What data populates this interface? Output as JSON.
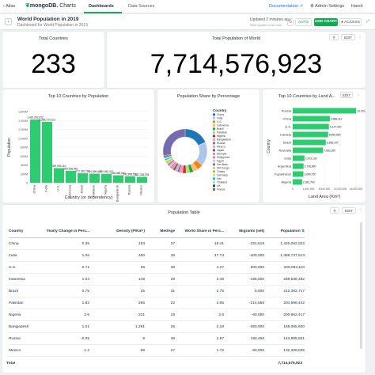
{
  "nav": {
    "atlas": "Atlas",
    "brand": "mongoDB.",
    "brand_suffix": "Charts",
    "tabs": [
      "Dashboards",
      "Data Sources"
    ],
    "documentation": "Documentation",
    "admin": "Admin Settings",
    "user": "Harsh"
  },
  "dashboard": {
    "title": "World Population in 2019",
    "subtitle": "Dashboard for World Population in 2019",
    "updated": "Updated 2 minutes ago",
    "updated_sub": "Next update in an hour",
    "auto": "AUTO",
    "add_chart": "ADD CHART",
    "access": "ACCESS"
  },
  "panel_buttons": {
    "edit": "EDIT"
  },
  "total_countries": {
    "title": "Total Countries",
    "value": "233"
  },
  "total_population": {
    "title": "Total Population of World",
    "value": "7,714,576,923"
  },
  "colors": {
    "bar": "#2ecc71",
    "accent": "#13aa52",
    "link": "#1a73e8"
  },
  "chart_data": [
    {
      "type": "bar",
      "title": "Top 10 Countries by Population",
      "xlabel": "Country (or dependency)",
      "ylabel": "Population",
      "categories": [
        "China",
        "India",
        "U.S.",
        "Indonesia",
        "Brazil",
        "Pakistan",
        "Nigeria",
        "Bangladesh",
        "Russia",
        "Mexico"
      ],
      "values": [
        1420062022,
        1368737513,
        329093110,
        269536482,
        212392717,
        204596442,
        200962417,
        168065920,
        143895551,
        132328035
      ],
      "labels": [
        "1,420,062,022",
        "1,368,737,513",
        "329,093,110",
        "269,536,482",
        "212,392,717",
        "204,596,442",
        "200,962,417",
        "168,065,920",
        "143,895,551",
        "132,328,035"
      ],
      "yticks": [
        "1,600M",
        "1,400M",
        "1,200M",
        "1,000M",
        "800M",
        "600M",
        "400M",
        "200M",
        "0"
      ],
      "ylim": [
        0,
        1600000000
      ]
    },
    {
      "type": "pie",
      "title": "Population Share by Percentage",
      "legend_title": "Country",
      "legend": [
        "China",
        "India",
        "U.S.",
        "Indonesia",
        "Brazil",
        "Pakistan",
        "Nigeria",
        "Bangladesh",
        "Russia",
        "Mexico",
        "Japan",
        "Ethiopia",
        "Philippines",
        "Egypt",
        "Viet Nam",
        "DR Congo",
        "Turkey",
        "Germany",
        "Iran",
        "Thailand",
        "UK",
        "France"
      ],
      "colors": [
        "#1f77b4",
        "#aec7e8",
        "#ff7f0e",
        "#ffbb78",
        "#2ca02c",
        "#98df8a",
        "#d62728",
        "#ff9896",
        "#9467bd",
        "#c5b0d5",
        "#8c564b",
        "#c49c94",
        "#e377c2",
        "#f7b6d2",
        "#7f7f7f",
        "#c7c7c7",
        "#bcbd22",
        "#dbdb8d",
        "#17becf",
        "#9edae5",
        "#393b79",
        "#637939"
      ],
      "values": [
        18.41,
        17.74,
        4.27,
        3.49,
        2.75,
        2.65,
        2.6,
        2.18,
        1.87,
        1.72,
        1.64,
        1.44,
        1.37,
        1.31,
        1.26,
        1.12,
        1.07,
        1.06,
        1.07,
        0.9,
        0.86,
        0.84,
        28.38
      ]
    },
    {
      "type": "bar",
      "orientation": "horizontal",
      "title": "Top 10 Countries by Land A...",
      "xlabel": "Land Area (Km²)",
      "ylabel": "Country",
      "categories": [
        "Russia",
        "China",
        "U.S.",
        "Canada",
        "Brazil",
        "Australia",
        "India",
        "Argentina",
        "Kazakhstan",
        "Algeria"
      ],
      "values": [
        16376870,
        9388211,
        9147420,
        8965590,
        8358140,
        7682300,
        2973190,
        2736690,
        2699700,
        2381740
      ],
      "labels": [
        "16,376,870",
        "9,388,211",
        "9,147,420",
        "8,965,590",
        "8,358,140",
        "7,682,300",
        "2,973,190",
        "2,736,690",
        "2,699,700",
        "2,381,740"
      ],
      "xticks": [
        "0",
        "4,000,000",
        "8,000,000",
        "12,000,000",
        "16,000,000"
      ],
      "xlim": [
        0,
        16000000
      ]
    }
  ],
  "table": {
    "title": "Population Table",
    "columns": [
      "Country",
      "Yearly Change in Perc...",
      "Density (P/Km²)",
      "MedAge",
      "World Share in Perc...",
      "Migrants (net)",
      "Population"
    ],
    "rows": [
      [
        "China",
        "0.35",
        "153",
        "37",
        "18.41",
        "-324,619",
        "1,420,062,022"
      ],
      [
        "India",
        "1.06",
        "460",
        "28",
        "17.74",
        "-400,000",
        "1,368,737,513"
      ],
      [
        "U.S.",
        "0.71",
        "36",
        "38",
        "4.27",
        "900,000",
        "329,093,110"
      ],
      [
        "Indonesia",
        "1.04",
        "149",
        "28",
        "3.49",
        "-165,000",
        "269,536,482"
      ],
      [
        "Brazil",
        "0.75",
        "25",
        "31",
        "2.75",
        "6,000",
        "212,392,717"
      ],
      [
        "Pakistan",
        "1.82",
        "265",
        "22",
        "2.65",
        "-214,556",
        "204,596,442"
      ],
      [
        "Nigeria",
        "2.6",
        "221",
        "18",
        "2.6",
        "-60,000",
        "200,962,417"
      ],
      [
        "Bangladesh",
        "1.01",
        "1,291",
        "26",
        "2.18",
        "-360,000",
        "168,065,920"
      ],
      [
        "Russia",
        "-0.05",
        "9",
        "39",
        "1.87",
        "182,456",
        "143,895,551"
      ],
      [
        "Mexico",
        "1.2",
        "68",
        "27",
        "1.72",
        "-60,000",
        "132,328,035"
      ]
    ],
    "total_label": "Total",
    "total_value": "7,714,576,923"
  }
}
